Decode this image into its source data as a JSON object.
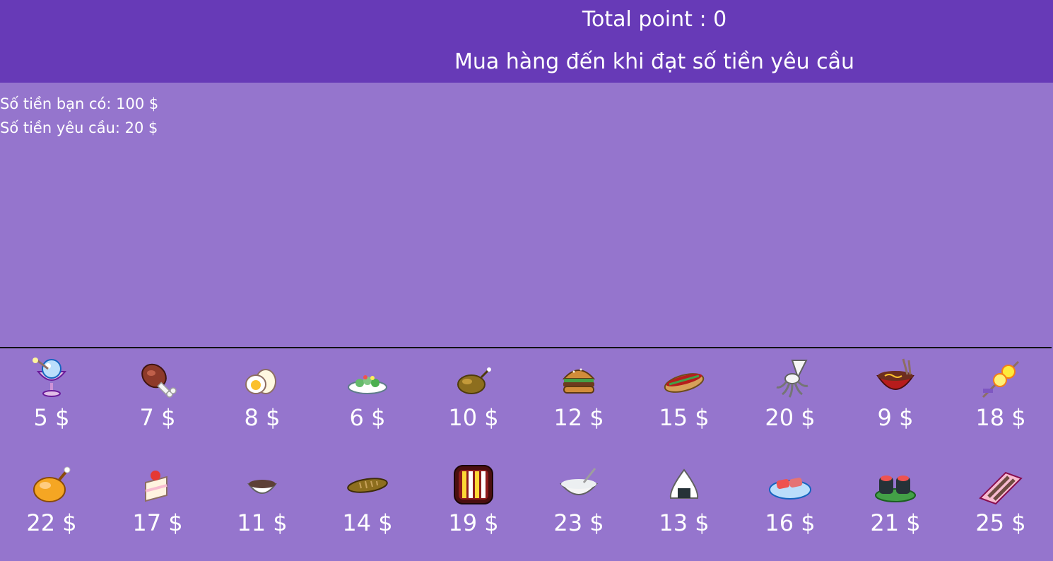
{
  "header": {
    "total_point_label": "Total point : 0",
    "instruction": "Mua hàng đến khi đạt số tiền yêu cầu"
  },
  "money": {
    "have": "Số tiền bạn có: 100 $",
    "required": "Số tiền yêu cầu: 20 $"
  },
  "colors": {
    "header_bg": "#673ab7",
    "page_bg": "#9575cd",
    "text": "#ffffff"
  },
  "shop": {
    "items": [
      {
        "icon": "ice-cream-sundae-icon",
        "price": "5 $"
      },
      {
        "icon": "meat-leg-icon",
        "price": "7 $"
      },
      {
        "icon": "boiled-egg-icon",
        "price": "8 $"
      },
      {
        "icon": "salad-plate-icon",
        "price": "6 $"
      },
      {
        "icon": "roast-bird-icon",
        "price": "10 $"
      },
      {
        "icon": "hamburger-icon",
        "price": "12 $"
      },
      {
        "icon": "hot-dog-icon",
        "price": "15 $"
      },
      {
        "icon": "squid-icon",
        "price": "20 $"
      },
      {
        "icon": "ramen-bowl-icon",
        "price": "9 $"
      },
      {
        "icon": "skewer-icon",
        "price": "18 $"
      },
      {
        "icon": "roast-chicken-icon",
        "price": "22 $"
      },
      {
        "icon": "strawberry-cake-icon",
        "price": "17 $"
      },
      {
        "icon": "soup-bowl-icon",
        "price": "11 $"
      },
      {
        "icon": "grilled-fish-icon",
        "price": "14 $"
      },
      {
        "icon": "bento-box-icon",
        "price": "19 $"
      },
      {
        "icon": "porridge-bowl-icon",
        "price": "23 $"
      },
      {
        "icon": "onigiri-icon",
        "price": "13 $"
      },
      {
        "icon": "sashimi-plate-icon",
        "price": "16 $"
      },
      {
        "icon": "sushi-roll-icon",
        "price": "21 $"
      },
      {
        "icon": "yakitori-plate-icon",
        "price": "25 $"
      }
    ]
  }
}
